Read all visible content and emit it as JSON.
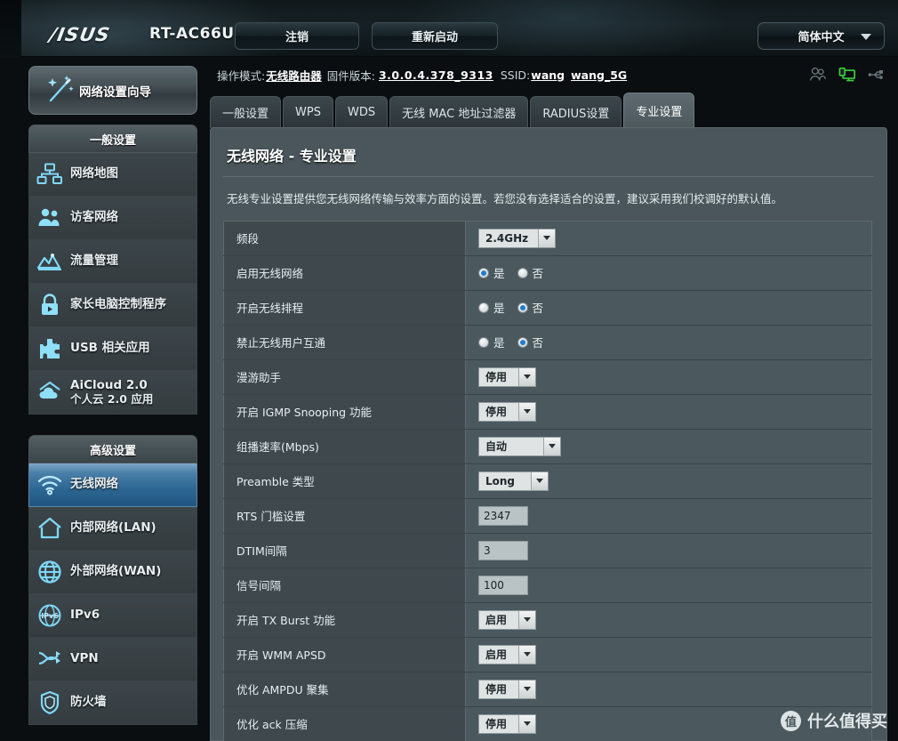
{
  "header": {
    "brand": "/ISUS",
    "model": "RT-AC66U",
    "logout_label": "注销",
    "reboot_label": "重新启动",
    "language": "简体中文"
  },
  "infobar": {
    "op_mode_label": "操作模式:",
    "op_mode_value": "无线路由器",
    "firmware_label": "固件版本:",
    "firmware_value": "3.0.0.4.378_9313",
    "ssid_label": "SSID:",
    "ssid_1": "wang",
    "ssid_2": "wang_5G",
    "icons": [
      "clients-icon",
      "network-monitor-icon",
      "usb-icon"
    ]
  },
  "sidebar": {
    "wizard_label": "网络设置向导",
    "wizard_icon": "magic-wand-icon",
    "groups": [
      {
        "title": "一般设置",
        "items": [
          {
            "label": "网络地图",
            "icon": "network-map-icon",
            "active": false
          },
          {
            "label": "访客网络",
            "icon": "guest-network-icon",
            "active": false
          },
          {
            "label": "流量管理",
            "icon": "traffic-manager-icon",
            "active": false
          },
          {
            "label": "家长电脑控制程序",
            "icon": "parental-control-icon",
            "active": false
          },
          {
            "label": "USB 相关应用",
            "icon": "usb-application-icon",
            "active": false
          },
          {
            "label": "AiCloud 2.0",
            "sublabel": "个人云 2.0 应用",
            "icon": "aicloud-icon",
            "active": false
          }
        ]
      },
      {
        "title": "高级设置",
        "items": [
          {
            "label": "无线网络",
            "icon": "wireless-icon",
            "active": true
          },
          {
            "label": "内部网络(LAN)",
            "icon": "lan-icon",
            "active": false
          },
          {
            "label": "外部网络(WAN)",
            "icon": "wan-icon",
            "active": false
          },
          {
            "label": "IPv6",
            "icon": "ipv6-icon",
            "active": false
          },
          {
            "label": "VPN",
            "icon": "vpn-icon",
            "active": false
          },
          {
            "label": "防火墙",
            "icon": "firewall-icon",
            "active": false
          }
        ]
      }
    ]
  },
  "tabs": [
    {
      "label": "一般设置",
      "active": false
    },
    {
      "label": "WPS",
      "active": false
    },
    {
      "label": "WDS",
      "active": false
    },
    {
      "label": "无线 MAC 地址过滤器",
      "active": false
    },
    {
      "label": "RADIUS设置",
      "active": false
    },
    {
      "label": "专业设置",
      "active": true
    }
  ],
  "panel": {
    "title": "无线网络 - 专业设置",
    "description": "无线专业设置提供您无线网络传输与效率方面的设置。若您没有选择适合的设置，建议采用我们校调好的默认值。",
    "rows": [
      {
        "key": "频段",
        "type": "select",
        "value": "2.4GHz",
        "width": 66
      },
      {
        "key": "启用无线网络",
        "type": "radio",
        "options": [
          "是",
          "否"
        ],
        "selected": 0
      },
      {
        "key": "开启无线排程",
        "type": "radio",
        "options": [
          "是",
          "否"
        ],
        "selected": 1
      },
      {
        "key": "禁止无线用户互通",
        "type": "radio",
        "options": [
          "是",
          "否"
        ],
        "selected": 1
      },
      {
        "key": "漫游助手",
        "type": "select",
        "value": "停用",
        "width": 44
      },
      {
        "key": "开启 IGMP Snooping 功能",
        "type": "select",
        "value": "停用",
        "width": 44
      },
      {
        "key": "组播速率(Mbps)",
        "type": "select",
        "value": "自动",
        "width": 72
      },
      {
        "key": "Preamble 类型",
        "type": "select",
        "value": "Long",
        "width": 58
      },
      {
        "key": "RTS 门槛设置",
        "type": "text",
        "value": "2347"
      },
      {
        "key": "DTIM间隔",
        "type": "text",
        "value": "3"
      },
      {
        "key": "信号间隔",
        "type": "text",
        "value": "100"
      },
      {
        "key": "开启 TX Burst 功能",
        "type": "select",
        "value": "启用",
        "width": 44
      },
      {
        "key": "开启 WMM APSD",
        "type": "select",
        "value": "启用",
        "width": 44
      },
      {
        "key": "优化 AMPDU 聚集",
        "type": "select",
        "value": "停用",
        "width": 44
      },
      {
        "key": "优化 ack 压缩",
        "type": "select",
        "value": "停用",
        "width": 44
      }
    ]
  },
  "watermark": {
    "badge": "值",
    "text": "什么值得买"
  },
  "colors": {
    "accent_blue": "#2d6793",
    "panel_bg": "#4a565b",
    "row_key_bg": "#3e484d",
    "radio_dot": "#1f7ccf",
    "active_green": "#3ecf3e"
  }
}
